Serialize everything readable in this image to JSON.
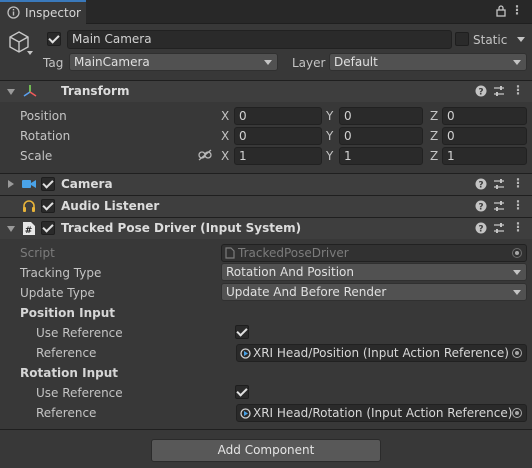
{
  "tab": {
    "title": "Inspector",
    "icons": [
      "info-icon",
      "lock-icon",
      "kebab-menu-icon"
    ]
  },
  "gameobject": {
    "active": true,
    "name": "Main Camera",
    "static_label": "Static",
    "static_checked": false,
    "tag_label": "Tag",
    "tag_value": "MainCamera",
    "layer_label": "Layer",
    "layer_value": "Default"
  },
  "transform": {
    "title": "Transform",
    "rows": [
      {
        "label": "Position",
        "x": "0",
        "y": "0",
        "z": "0"
      },
      {
        "label": "Rotation",
        "x": "0",
        "y": "0",
        "z": "0"
      },
      {
        "label": "Scale",
        "x": "1",
        "y": "1",
        "z": "1"
      }
    ],
    "axes": [
      "X",
      "Y",
      "Z"
    ]
  },
  "camera": {
    "title": "Camera",
    "enabled": true
  },
  "audio_listener": {
    "title": "Audio Listener",
    "enabled": true
  },
  "tracked_pose_driver": {
    "title": "Tracked Pose Driver (Input System)",
    "enabled": true,
    "script_label": "Script",
    "script_value": "TrackedPoseDriver",
    "tracking_type_label": "Tracking Type",
    "tracking_type_value": "Rotation And Position",
    "update_type_label": "Update Type",
    "update_type_value": "Update And Before Render",
    "position_input_label": "Position Input",
    "position_use_reference_label": "Use Reference",
    "position_use_reference": true,
    "position_reference_label": "Reference",
    "position_reference_value": "XRI Head/Position (Input Action Reference)",
    "rotation_input_label": "Rotation Input",
    "rotation_use_reference_label": "Use Reference",
    "rotation_use_reference": true,
    "rotation_reference_label": "Reference",
    "rotation_reference_value": "XRI Head/Rotation (Input Action Reference)"
  },
  "add_component_label": "Add Component",
  "colors": {
    "background": "#383838",
    "field": "#2a2a2a",
    "header": "#3e3e3e",
    "button": "#585858"
  }
}
